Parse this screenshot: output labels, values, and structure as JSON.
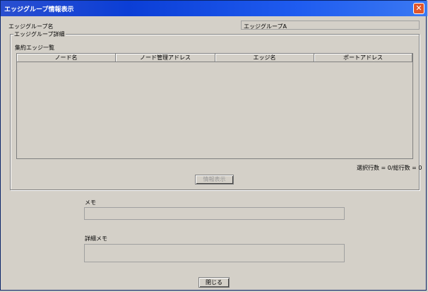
{
  "window": {
    "title": "エッジグループ情報表示"
  },
  "edge_group_name": {
    "label": "エッジグループ名",
    "value": "エッジグループA"
  },
  "detail_group": {
    "legend": "エッジグループ詳細"
  },
  "aggregate_edges": {
    "label": "集約エッジ一覧",
    "columns": [
      "ノード名",
      "ノード管理アドレス",
      "エッジ名",
      "ポートアドレス"
    ],
    "rows": []
  },
  "row_count_text": "選択行数 = 0/総行数 = 0",
  "info_button": {
    "label": "情報表示",
    "disabled": true
  },
  "memo": {
    "label": "メモ",
    "value": ""
  },
  "detail_memo": {
    "label": "詳細メモ",
    "value": ""
  },
  "close_button": {
    "label": "閉じる"
  }
}
